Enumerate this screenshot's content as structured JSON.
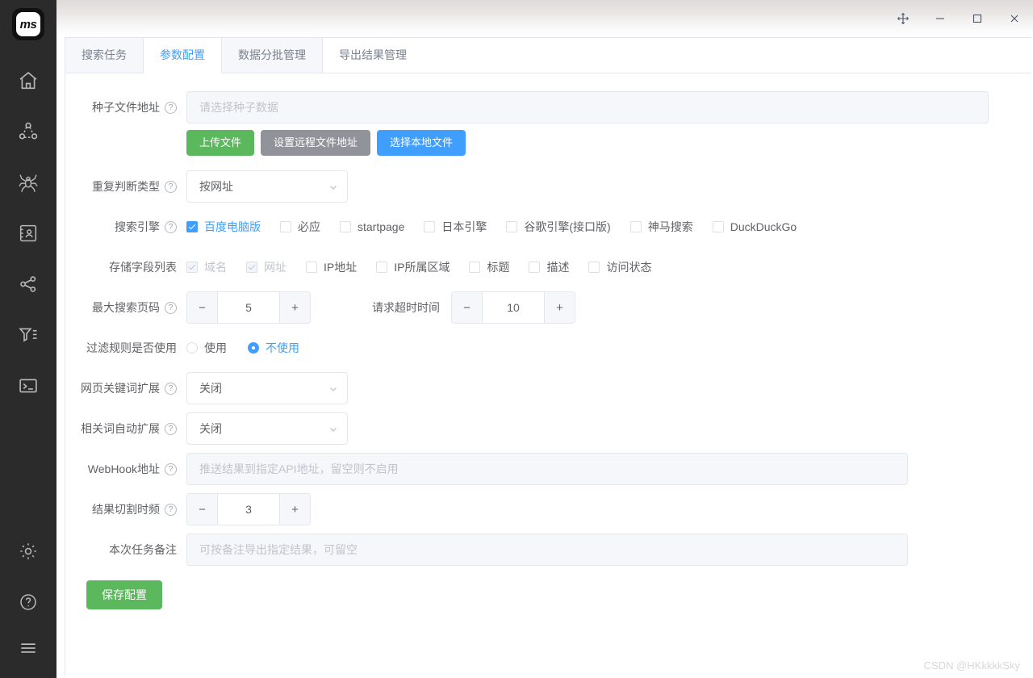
{
  "window": {
    "logo_text": "ms",
    "controls": [
      {
        "name": "move",
        "label": "✥"
      },
      {
        "name": "minimize",
        "label": "—"
      },
      {
        "name": "maximize",
        "label": "□"
      },
      {
        "name": "close",
        "label": "✕"
      }
    ]
  },
  "rail": {
    "items": [
      {
        "name": "home-icon",
        "label": "首页"
      },
      {
        "name": "share-nodes-icon",
        "label": "节点"
      },
      {
        "name": "spider-icon",
        "label": "爬虫"
      },
      {
        "name": "contact-card-icon",
        "label": "联系人"
      },
      {
        "name": "network-share-icon",
        "label": "分享"
      },
      {
        "name": "filter-icon",
        "label": "过滤"
      },
      {
        "name": "terminal-icon",
        "label": "终端"
      }
    ],
    "bottom_items": [
      {
        "name": "gear-icon",
        "label": "设置"
      },
      {
        "name": "help-icon",
        "label": "帮助"
      },
      {
        "name": "menu-icon",
        "label": "菜单"
      }
    ]
  },
  "tabs": [
    {
      "label": "搜索任务",
      "active": false
    },
    {
      "label": "参数配置",
      "active": true
    },
    {
      "label": "数据分批管理",
      "active": false
    },
    {
      "label": "导出结果管理",
      "active": false
    }
  ],
  "form": {
    "seed_file": {
      "label": "种子文件地址",
      "placeholder": "请选择种子数据",
      "value": "",
      "buttons": [
        {
          "label": "上传文件",
          "style": "green"
        },
        {
          "label": "设置远程文件地址",
          "style": "grey"
        },
        {
          "label": "选择本地文件",
          "style": "blue"
        }
      ]
    },
    "dedup_type": {
      "label": "重复判断类型",
      "value": "按网址"
    },
    "search_engines": {
      "label": "搜索引擎",
      "options": [
        {
          "label": "百度电脑版",
          "checked": true
        },
        {
          "label": "必应",
          "checked": false
        },
        {
          "label": "startpage",
          "checked": false
        },
        {
          "label": "日本引擎",
          "checked": false
        },
        {
          "label": "谷歌引擎(接口版)",
          "checked": false
        },
        {
          "label": "神马搜索",
          "checked": false
        },
        {
          "label": "DuckDuckGo",
          "checked": false
        }
      ]
    },
    "store_fields": {
      "label": "存储字段列表",
      "options": [
        {
          "label": "域名",
          "checked": true,
          "disabled": true
        },
        {
          "label": "网址",
          "checked": true,
          "disabled": true
        },
        {
          "label": "IP地址",
          "checked": false,
          "disabled": false
        },
        {
          "label": "IP所属区域",
          "checked": false,
          "disabled": false
        },
        {
          "label": "标题",
          "checked": false,
          "disabled": false
        },
        {
          "label": "描述",
          "checked": false,
          "disabled": false
        },
        {
          "label": "访问状态",
          "checked": false,
          "disabled": false
        }
      ]
    },
    "max_page": {
      "label": "最大搜索页码",
      "value": "5",
      "minus": "−",
      "plus": "+"
    },
    "timeout": {
      "label": "请求超时时间",
      "value": "10",
      "minus": "−",
      "plus": "+"
    },
    "filter_rule": {
      "label": "过滤规则是否使用",
      "options": [
        {
          "label": "使用",
          "selected": false
        },
        {
          "label": "不使用",
          "selected": true
        }
      ]
    },
    "keyword_expand": {
      "label": "网页关键词扩展",
      "value": "关闭"
    },
    "related_expand": {
      "label": "相关词自动扩展",
      "value": "关闭"
    },
    "webhook": {
      "label": "WebHook地址",
      "placeholder": "推送结果到指定API地址，留空则不启用",
      "value": ""
    },
    "split_freq": {
      "label": "结果切割时频",
      "value": "3",
      "minus": "−",
      "plus": "+"
    },
    "remark": {
      "label": "本次任务备注",
      "placeholder": "可按备注导出指定结果，可留空",
      "value": ""
    },
    "save_button": "保存配置",
    "help_glyph": "?"
  },
  "watermark": "CSDN @HKkkkkSky"
}
